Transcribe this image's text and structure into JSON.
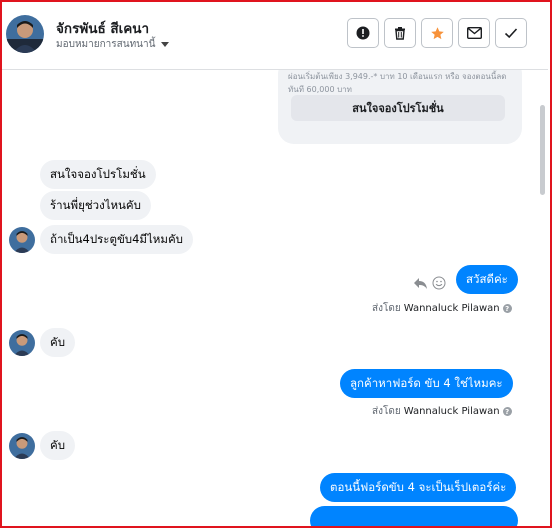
{
  "header": {
    "contact_name": "จักรพันธ์ สีเคนา",
    "assign_label": "มอบหมายการสนทนานี้",
    "actions": [
      {
        "name": "mark-spam-button",
        "icon": "exclamation-icon"
      },
      {
        "name": "delete-button",
        "icon": "trash-icon"
      },
      {
        "name": "star-button",
        "icon": "star-icon",
        "color": "#f7923a"
      },
      {
        "name": "mark-unread-button",
        "icon": "envelope-icon"
      },
      {
        "name": "mark-done-button",
        "icon": "check-icon"
      }
    ]
  },
  "promo": {
    "text": "ผ่อนเริ่มต้นเพียง 3,949.-* บาท 10 เดือนแรก หรือ จองตอนนี้ลดทันที 60,000 บาท",
    "button_label": "สนใจจองโปรโมชั่น"
  },
  "messages": {
    "m1": "สนใจจองโปรโมชั่น",
    "m2": "ร้านพี่ยุช่วงไหนคับ",
    "m3": "ถ้าเป็น4ประตูขับ4มีไหมคับ",
    "m4": "สวัสดีค่ะ",
    "m5": "คับ",
    "m6": "ลูกค้าหาฟอร์ด ขับ 4 ใช่ไหมคะ",
    "m7": "คับ",
    "m8": "ตอนนี้ฟอร์ดขับ 4 จะเป็นเร็ปเตอร์ค่ะ"
  },
  "sent_by": {
    "prefix": "ส่งโดย",
    "agent": "Wannaluck Pilawan",
    "info_glyph": "?"
  },
  "colors": {
    "outgoing": "#0084ff",
    "incoming": "#f0f2f5",
    "frame": "#e0141e"
  }
}
